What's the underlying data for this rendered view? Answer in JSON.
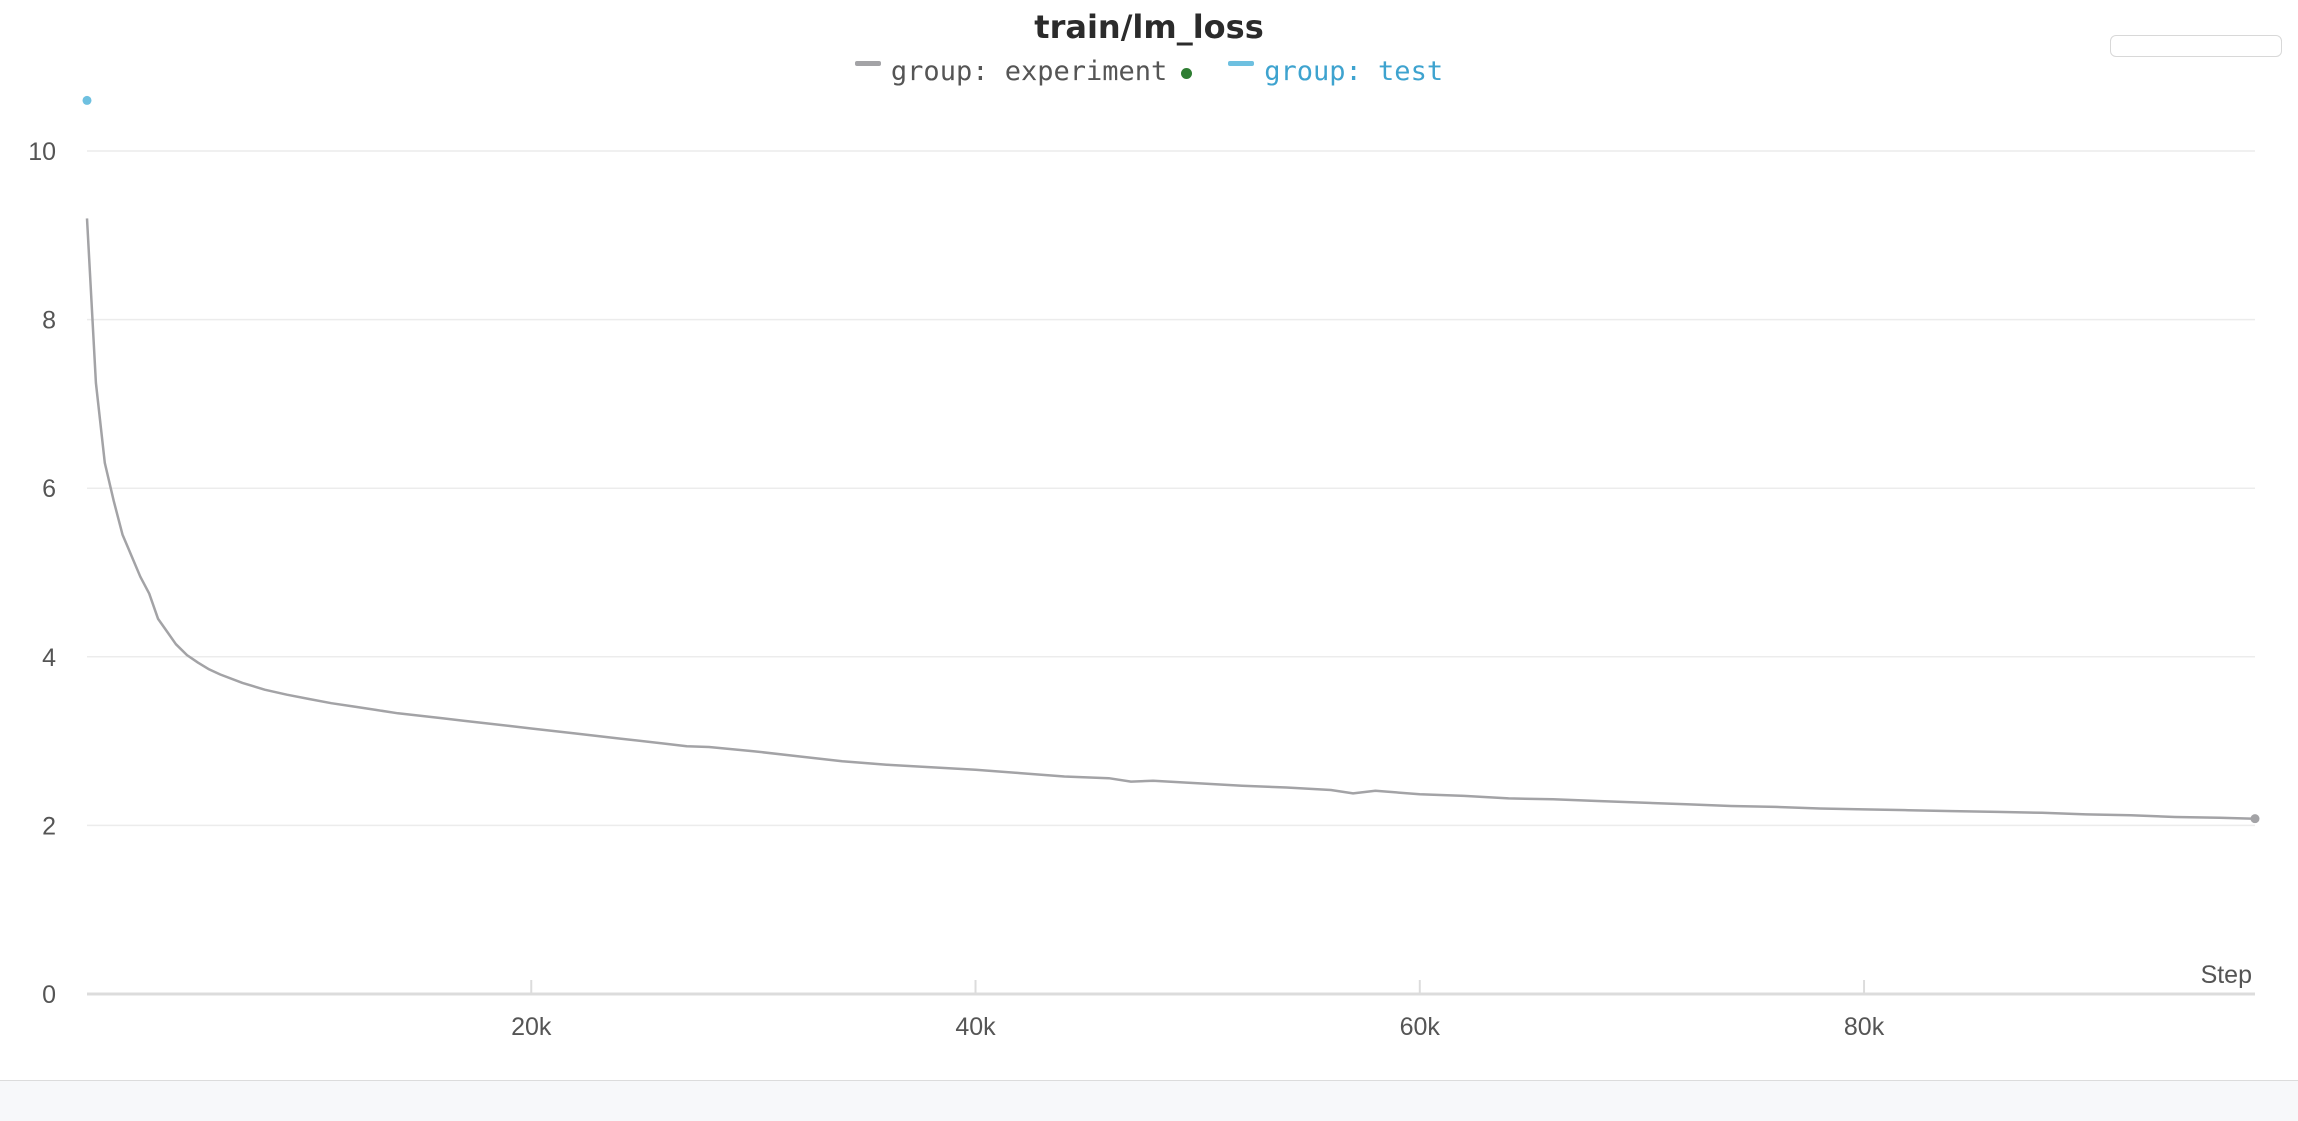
{
  "chart_data": {
    "type": "line",
    "title": "train/lm_loss",
    "xlabel": "Step",
    "ylabel": "",
    "xlim": [
      0,
      97600
    ],
    "ylim": [
      0,
      10
    ],
    "xticks": [
      20000,
      40000,
      60000,
      80000
    ],
    "xtick_labels": [
      "20k",
      "40k",
      "60k",
      "80k"
    ],
    "yticks": [
      0,
      2,
      4,
      6,
      8,
      10
    ],
    "ytick_labels": [
      "0",
      "2",
      "4",
      "6",
      "8",
      "10"
    ],
    "grid": true,
    "legend_position": "top-center",
    "series": [
      {
        "name": "group: experiment",
        "color": "#a3a3a6",
        "running_indicator_color": "#2e7d32",
        "x": [
          0,
          400,
          800,
          1200,
          1600,
          2000,
          2400,
          2800,
          3200,
          3600,
          4000,
          4500,
          5000,
          5500,
          6000,
          7000,
          8000,
          9000,
          10000,
          11000,
          12000,
          13000,
          14000,
          15000,
          16000,
          17000,
          18000,
          19000,
          20000,
          22000,
          24000,
          26000,
          27000,
          28000,
          30000,
          32000,
          34000,
          36000,
          38000,
          40000,
          42000,
          44000,
          46000,
          47000,
          48000,
          50000,
          52000,
          54000,
          56000,
          57000,
          58000,
          60000,
          62000,
          64000,
          66000,
          68000,
          70000,
          72000,
          74000,
          76000,
          78000,
          80000,
          82000,
          84000,
          86000,
          88000,
          90000,
          92000,
          94000,
          96000,
          97600
        ],
        "values": [
          9.2,
          7.25,
          6.3,
          5.85,
          5.45,
          5.2,
          4.95,
          4.75,
          4.45,
          4.3,
          4.15,
          4.02,
          3.93,
          3.85,
          3.79,
          3.69,
          3.61,
          3.55,
          3.5,
          3.45,
          3.41,
          3.37,
          3.33,
          3.3,
          3.27,
          3.24,
          3.21,
          3.18,
          3.15,
          3.09,
          3.03,
          2.97,
          2.94,
          2.93,
          2.88,
          2.82,
          2.76,
          2.72,
          2.69,
          2.66,
          2.62,
          2.58,
          2.56,
          2.52,
          2.53,
          2.5,
          2.47,
          2.45,
          2.42,
          2.38,
          2.41,
          2.37,
          2.35,
          2.32,
          2.31,
          2.29,
          2.27,
          2.25,
          2.23,
          2.22,
          2.2,
          2.19,
          2.18,
          2.17,
          2.16,
          2.15,
          2.13,
          2.12,
          2.1,
          2.09,
          2.08
        ]
      },
      {
        "name": "group: test",
        "color": "#6ec0e0",
        "x": [
          0
        ],
        "values": [
          10.6
        ]
      }
    ]
  }
}
